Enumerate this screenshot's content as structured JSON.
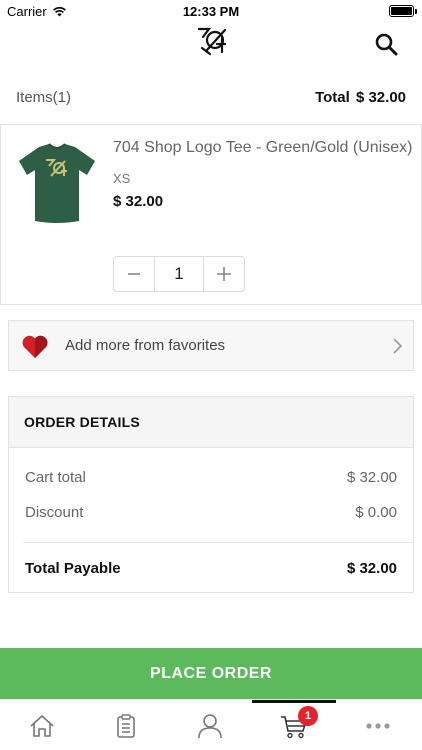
{
  "status_bar": {
    "carrier": "Carrier",
    "time": "12:33 PM"
  },
  "header": {
    "logo_icon": "shop-logo-icon",
    "search_icon": "search-icon"
  },
  "summary": {
    "items_label": "Items(1)",
    "total_label": "Total",
    "total_value": "$ 32.00"
  },
  "cart_item": {
    "name": "704 Shop Logo Tee - Green/Gold (Unisex)",
    "size": "XS",
    "price": "$ 32.00",
    "quantity": "1",
    "colors": {
      "shirt": "#2e5e45",
      "print": "#c8c27a"
    }
  },
  "favorites": {
    "label": "Add more from favorites",
    "heart_color": "#d41f2a"
  },
  "order_details": {
    "title": "ORDER DETAILS",
    "cart_total_label": "Cart total",
    "cart_total_value": "$ 32.00",
    "discount_label": "Discount",
    "discount_value": "$ 0.00",
    "payable_label": "Total Payable",
    "payable_value": "$ 32.00"
  },
  "place_order": {
    "label": "PLACE ORDER",
    "color": "#5cba5c"
  },
  "tab_bar": {
    "tabs": [
      {
        "icon": "home-icon"
      },
      {
        "icon": "clipboard-icon"
      },
      {
        "icon": "user-icon"
      },
      {
        "icon": "cart-icon",
        "badge": "1",
        "active": true
      },
      {
        "icon": "more-icon"
      }
    ],
    "badge_color": "#e8222b"
  }
}
